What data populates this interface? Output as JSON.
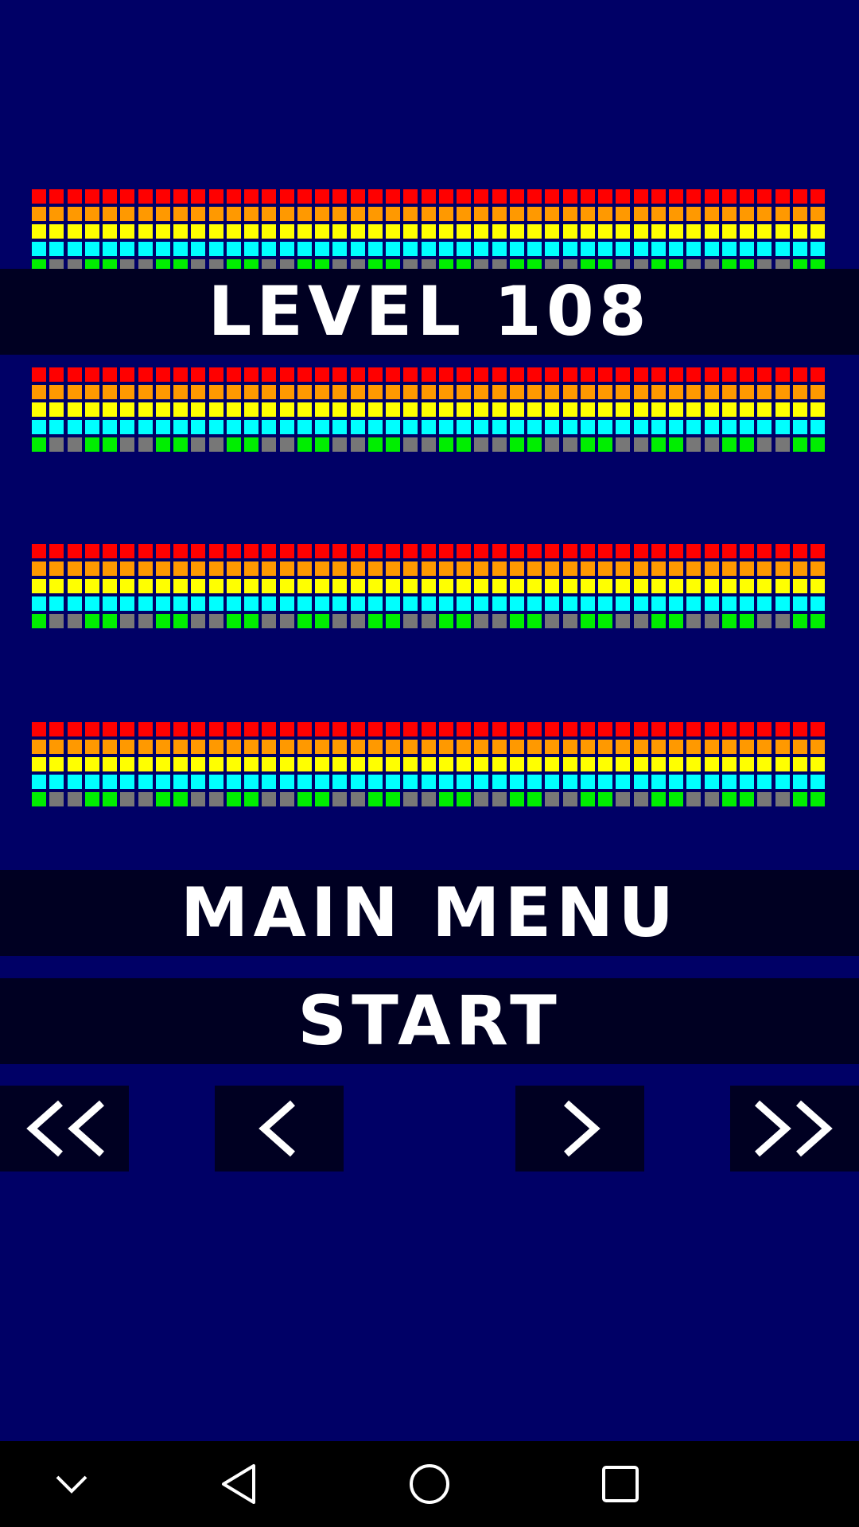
{
  "level": {
    "label": "LEVEL 108"
  },
  "menu": {
    "main_menu_label": "MAIN MENU",
    "start_label": "START"
  },
  "navigation": {
    "first_icon": "double-chevron-left-icon",
    "prev_icon": "chevron-left-icon",
    "next_icon": "chevron-right-icon",
    "last_icon": "double-chevron-right-icon"
  },
  "system_nav": {
    "icons": [
      "chevron-down-icon",
      "back-triangle-icon",
      "home-circle-icon",
      "recents-square-icon"
    ]
  },
  "bricks": {
    "columns": 45,
    "row_colors": [
      "#ff0000",
      "#ff9900",
      "#ffff00",
      "#00ffff",
      "mixed"
    ],
    "bottom_row_pattern": [
      "#00ee00",
      "#777777",
      "#777777",
      "#00ee00",
      "#00ee00",
      "#777777",
      "#777777",
      "#00ee00",
      "#00ee00",
      "#777777",
      "#777777",
      "#00ee00",
      "#00ee00",
      "#777777",
      "#777777",
      "#00ee00",
      "#00ee00",
      "#777777",
      "#777777",
      "#00ee00",
      "#00ee00",
      "#777777",
      "#777777",
      "#00ee00",
      "#00ee00",
      "#777777",
      "#777777",
      "#00ee00",
      "#00ee00",
      "#777777",
      "#777777",
      "#00ee00",
      "#00ee00",
      "#777777",
      "#777777",
      "#00ee00",
      "#00ee00",
      "#777777",
      "#777777",
      "#00ee00",
      "#00ee00",
      "#777777",
      "#777777",
      "#00ee00",
      "#00ee00"
    ]
  },
  "colors": {
    "background": "#000066",
    "bar": "#000022",
    "text": "#ffffff"
  }
}
